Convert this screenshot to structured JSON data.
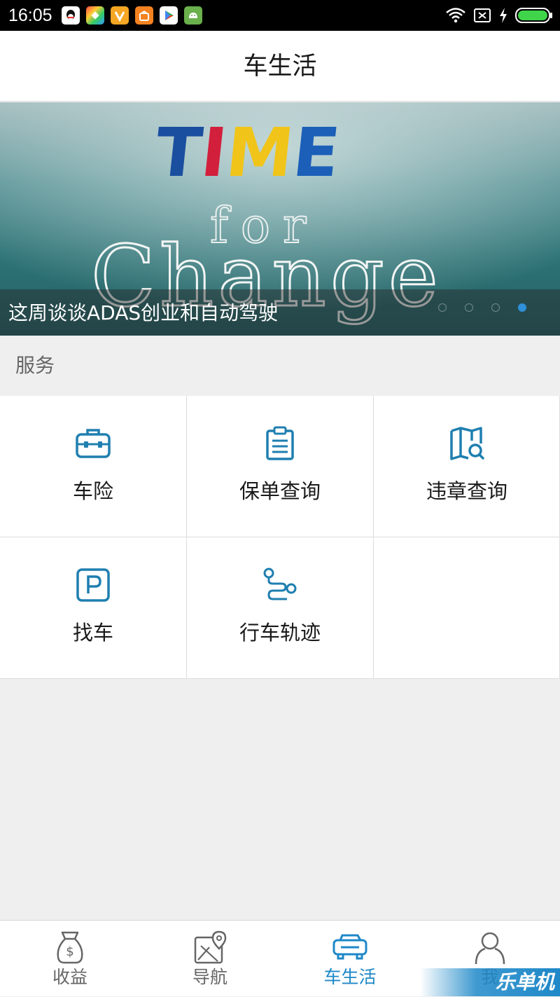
{
  "status_bar": {
    "time": "16:05",
    "notification_icons": [
      "qq-icon",
      "colorful-app-icon",
      "v-app-icon",
      "shopping-app-icon",
      "play-store-icon",
      "android-app-icon"
    ],
    "system_icons": [
      "wifi-icon",
      "sim-off-icon",
      "charging-icon",
      "battery-icon"
    ]
  },
  "header": {
    "title": "车生活"
  },
  "banner": {
    "caption": "这周谈谈ADAS创业和自动驾驶",
    "image_text_top": "TIME",
    "image_text_mid": "for",
    "image_text_bottom": "Change",
    "slide_count": 4,
    "active_slide": 4
  },
  "services": {
    "section_title": "服务",
    "items": [
      {
        "label": "车险",
        "icon": "toolbox-icon"
      },
      {
        "label": "保单查询",
        "icon": "clipboard-list-icon"
      },
      {
        "label": "违章查询",
        "icon": "map-search-icon"
      },
      {
        "label": "找车",
        "icon": "parking-icon"
      },
      {
        "label": "行车轨迹",
        "icon": "route-icon"
      }
    ]
  },
  "bottom_nav": {
    "items": [
      {
        "label": "收益",
        "icon": "money-bag-icon",
        "active": false
      },
      {
        "label": "导航",
        "icon": "map-pin-icon",
        "active": false
      },
      {
        "label": "车生活",
        "icon": "car-icon",
        "active": true
      },
      {
        "label": "我",
        "icon": "person-icon",
        "active": false
      }
    ]
  },
  "watermark": {
    "text": "乐单机"
  },
  "colors": {
    "accent": "#1e88c8",
    "icon_blue": "#1f7fb0",
    "background": "#efefef",
    "divider": "#dcdcdc"
  }
}
